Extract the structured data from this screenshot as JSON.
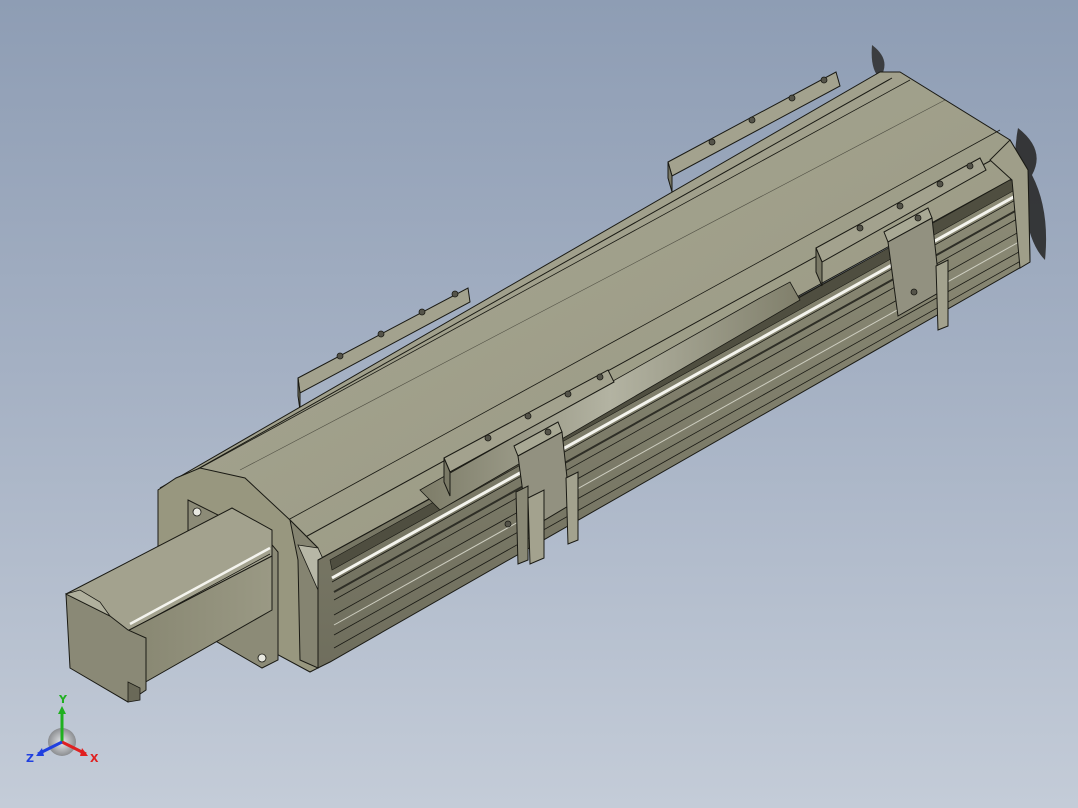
{
  "colors": {
    "viewport_top": "#8e9db4",
    "viewport_bottom": "#c4ccd8",
    "body_light": "#a6a692",
    "body_mid": "#8f8e79",
    "body_dark": "#6d6c5b",
    "edge": "#1a1a14",
    "rail_highlight": "#f4f4ee",
    "axis_x": "#e02020",
    "axis_y": "#20b020",
    "axis_z": "#2040e0"
  },
  "triad": {
    "x_label": "X",
    "y_label": "Y",
    "z_label": "Z"
  },
  "icons": {
    "triad": "axis-triad-icon"
  }
}
